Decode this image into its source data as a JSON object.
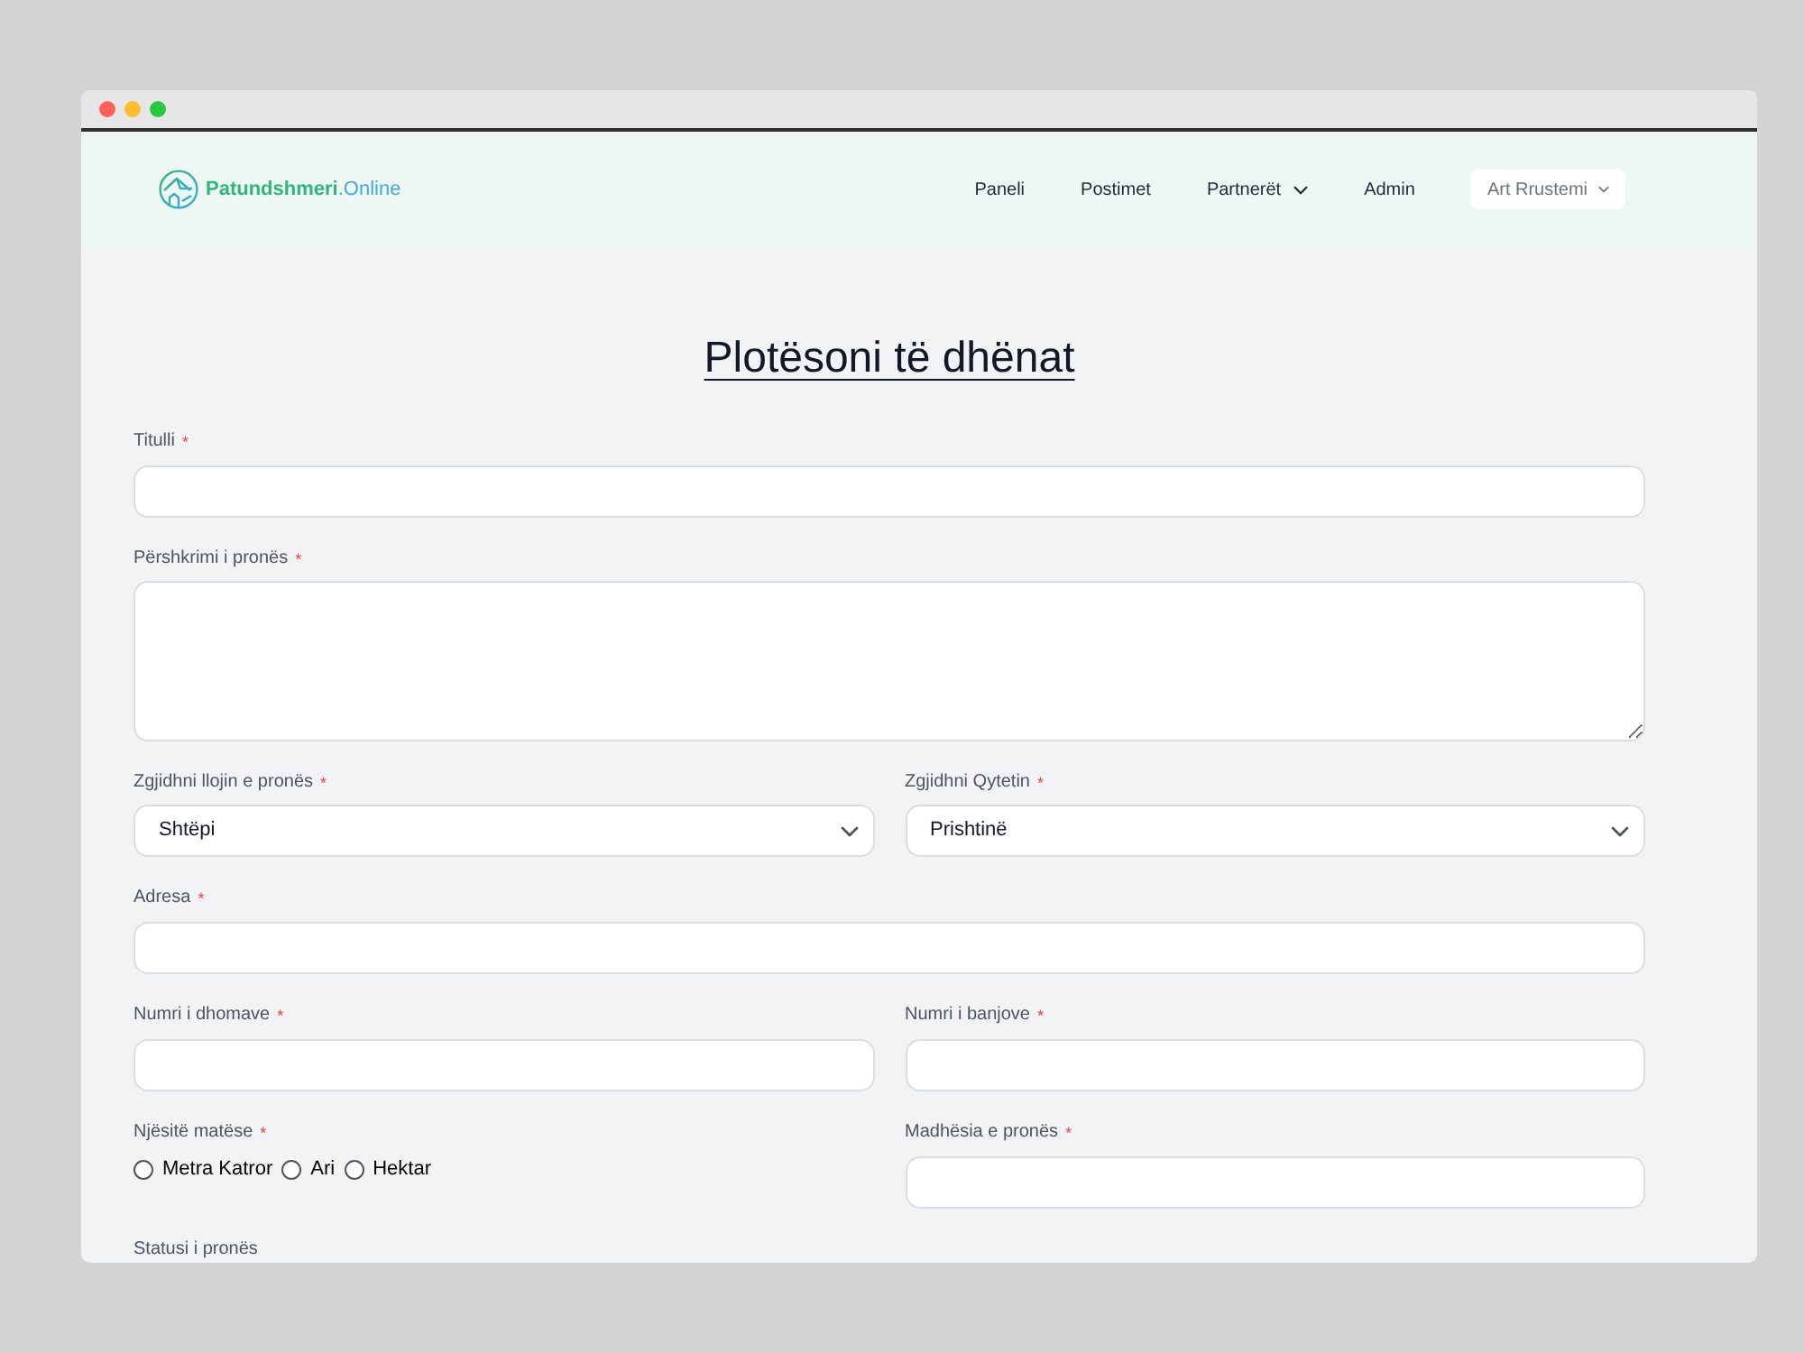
{
  "window": {
    "controls": [
      {
        "color": "#ff5f57"
      },
      {
        "color": "#febc2e"
      },
      {
        "color": "#28c840"
      }
    ]
  },
  "navbar": {
    "brand": {
      "name": "Patundshmeri",
      "suffix": ".Online"
    },
    "items": [
      {
        "label": "Paneli",
        "dropdown": false
      },
      {
        "label": "Postimet",
        "dropdown": false
      },
      {
        "label": "Partnerët",
        "dropdown": true
      },
      {
        "label": "Admin",
        "dropdown": false
      }
    ],
    "user_menu": {
      "label": "Art Rrustemi"
    }
  },
  "form": {
    "title": "Plotësoni të dhënat",
    "rows": [
      {
        "fields": [
          {
            "kind": "text",
            "label": "Titulli",
            "required_mark": "*"
          }
        ]
      },
      {
        "fields": [
          {
            "kind": "textarea",
            "label": "Përshkrimi i pronës",
            "required_mark": "*"
          }
        ]
      },
      {
        "fields": [
          {
            "kind": "select",
            "label": "Zgjidhni llojin e pronës",
            "required_mark": "*",
            "value": "Shtëpi"
          },
          {
            "kind": "select",
            "label": "Zgjidhni Qytetin",
            "required_mark": "*",
            "value": "Prishtinë"
          }
        ]
      },
      {
        "fields": [
          {
            "kind": "text",
            "label": "Adresa",
            "required_mark": "*"
          }
        ]
      },
      {
        "fields": [
          {
            "kind": "text",
            "label": "Numri i dhomave",
            "required_mark": "*"
          },
          {
            "kind": "text",
            "label": "Numri i banjove",
            "required_mark": "*"
          }
        ]
      },
      {
        "fields": [
          {
            "kind": "radio",
            "label": "Njësitë matëse",
            "required_mark": "*",
            "options": [
              {
                "label": "Metra Katror",
                "selected": false
              },
              {
                "label": "Ari",
                "selected": false
              },
              {
                "label": "Hektar",
                "selected": false
              }
            ]
          },
          {
            "kind": "text",
            "label": "Madhësia e pronës",
            "required_mark": "*"
          }
        ]
      },
      {
        "fields": [
          {
            "kind": "label",
            "label": "Statusi i pronës"
          }
        ]
      }
    ]
  }
}
